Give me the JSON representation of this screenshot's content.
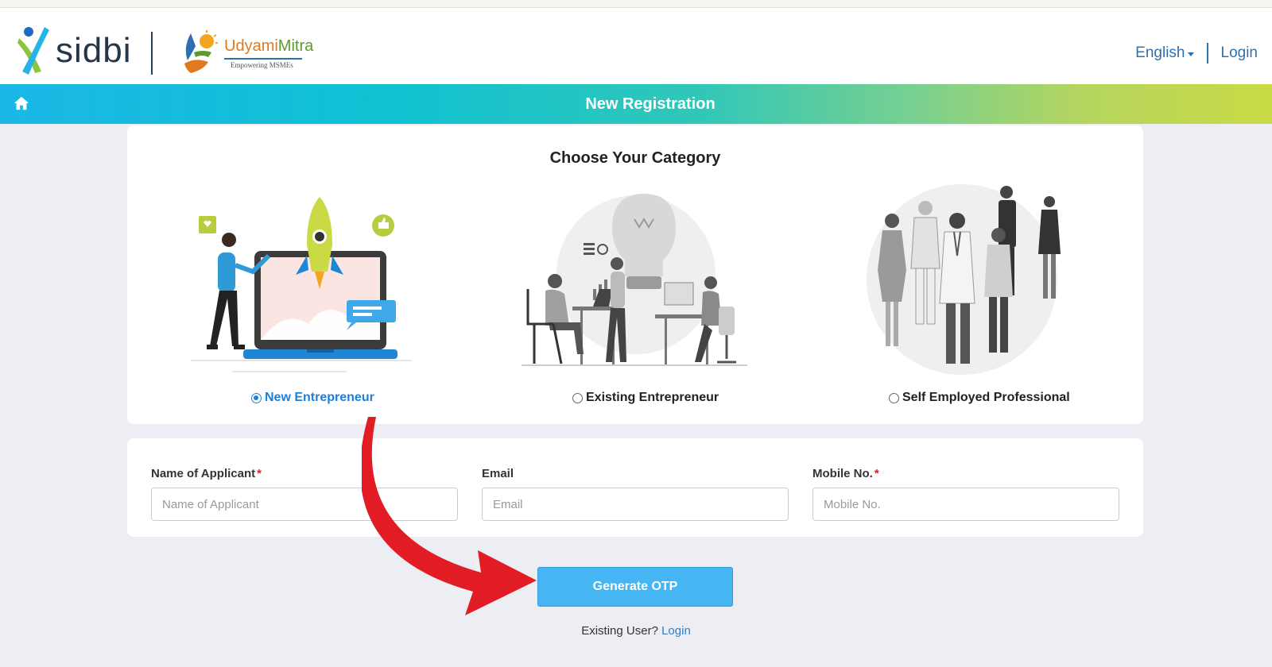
{
  "header": {
    "brand": "sidbi",
    "partner_brand_part1": "Udyami",
    "partner_brand_part2": "Mitra",
    "partner_tagline": "Empowering MSMEs",
    "language": "English",
    "login_label": "Login"
  },
  "banner": {
    "home_icon": "home-icon",
    "title": "New Registration"
  },
  "category": {
    "title": "Choose Your Category",
    "options": [
      {
        "label": "New Entrepreneur",
        "selected": true
      },
      {
        "label": "Existing Entrepreneur",
        "selected": false
      },
      {
        "label": "Self Employed Professional",
        "selected": false
      }
    ]
  },
  "form": {
    "name": {
      "label": "Name of Applicant",
      "placeholder": "Name of Applicant",
      "required_mark": "*"
    },
    "email": {
      "label": "Email",
      "placeholder": "Email"
    },
    "mobile": {
      "label": "Mobile No.",
      "placeholder": "Mobile No.",
      "required_mark": "*"
    }
  },
  "actions": {
    "generate_otp": "Generate OTP",
    "existing_user": "Existing User?",
    "login_link": "Login"
  },
  "colors": {
    "primary_blue": "#1d7fd8",
    "button_blue": "#45b6f3",
    "required_red": "#e21c24",
    "annotation_arrow": "#e21c24"
  }
}
